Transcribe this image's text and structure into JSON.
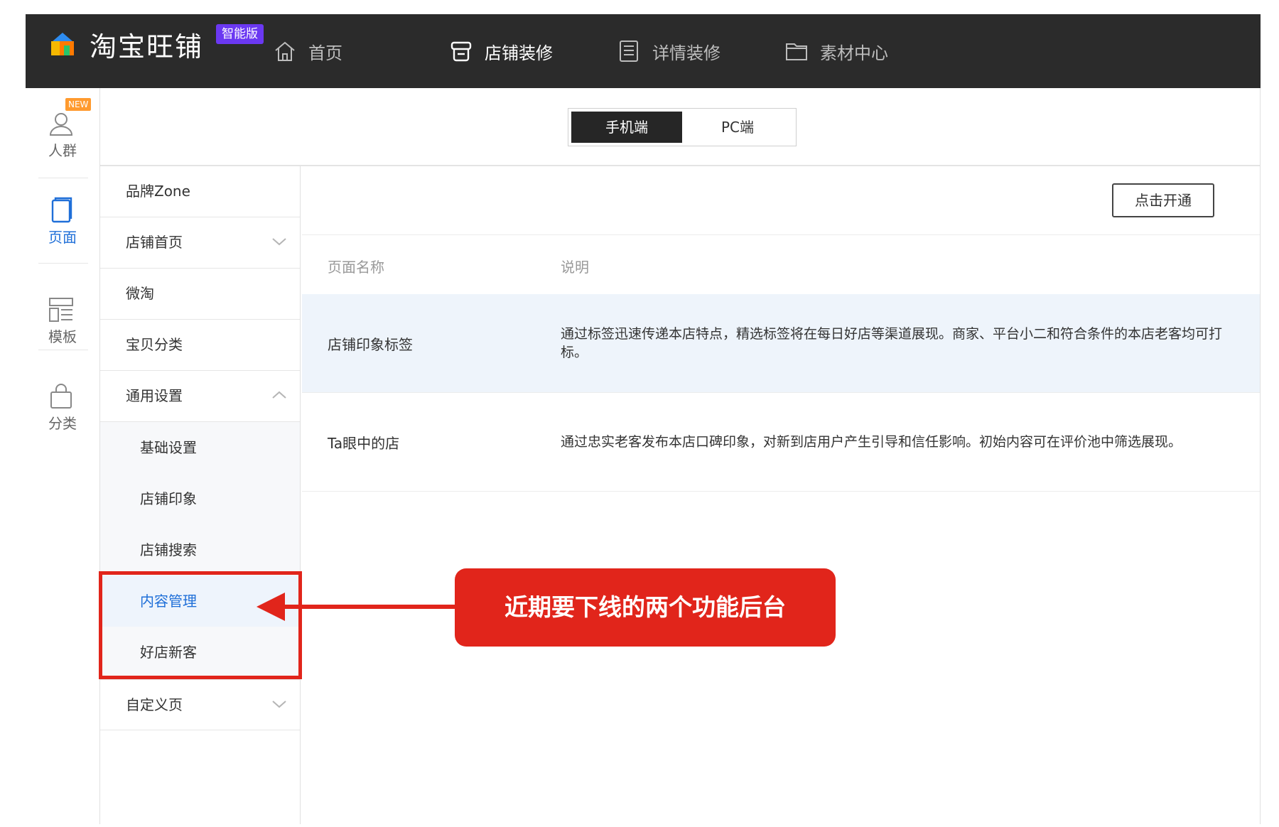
{
  "topbar": {
    "brand": "淘宝旺铺",
    "edition_badge": "智能版",
    "nav": [
      {
        "label": "首页",
        "icon": "home-icon",
        "active": false
      },
      {
        "label": "店铺装修",
        "icon": "store-icon",
        "active": true
      },
      {
        "label": "详情装修",
        "icon": "document-list-icon",
        "active": false
      },
      {
        "label": "素材中心",
        "icon": "folder-icon",
        "active": false
      }
    ]
  },
  "rail": {
    "items": [
      {
        "label": "人群",
        "icon": "user-icon",
        "badge": "NEW",
        "active": false
      },
      {
        "label": "页面",
        "icon": "page-icon",
        "active": true
      },
      {
        "label": "模板",
        "icon": "template-icon",
        "active": false
      },
      {
        "label": "分类",
        "icon": "bag-icon",
        "active": false
      }
    ]
  },
  "device_tabs": {
    "options": [
      "手机端",
      "PC端"
    ],
    "selected": "手机端"
  },
  "menu": {
    "items": [
      "品牌Zone",
      "店铺首页",
      "微淘",
      "宝贝分类",
      "通用设置",
      "自定义页"
    ],
    "general_settings_children": [
      "基础设置",
      "店铺印象",
      "店铺搜索",
      "内容管理",
      "好店新客"
    ],
    "active_child": "内容管理"
  },
  "panel": {
    "open_button": "点击开通",
    "columns": [
      "页面名称",
      "说明"
    ],
    "rows": [
      {
        "name": "店铺印象标签",
        "desc": "通过标签迅速传递本店特点，精选标签将在每日好店等渠道展现。商家、平台小二和符合条件的本店老客均可打标。"
      },
      {
        "name": "Ta眼中的店",
        "desc": "通过忠实老客发布本店口碑印象，对新到店用户产生引导和信任影响。初始内容可在评价池中筛选展现。"
      }
    ]
  },
  "annotation": {
    "callout": "近期要下线的两个功能后台",
    "color": "#e1251b"
  },
  "colors": {
    "topbar_bg": "#2b2b2b",
    "accent_blue": "#1f6fd8",
    "edition_badge": "#6b38f2",
    "new_badge": "#ff9a2e"
  }
}
